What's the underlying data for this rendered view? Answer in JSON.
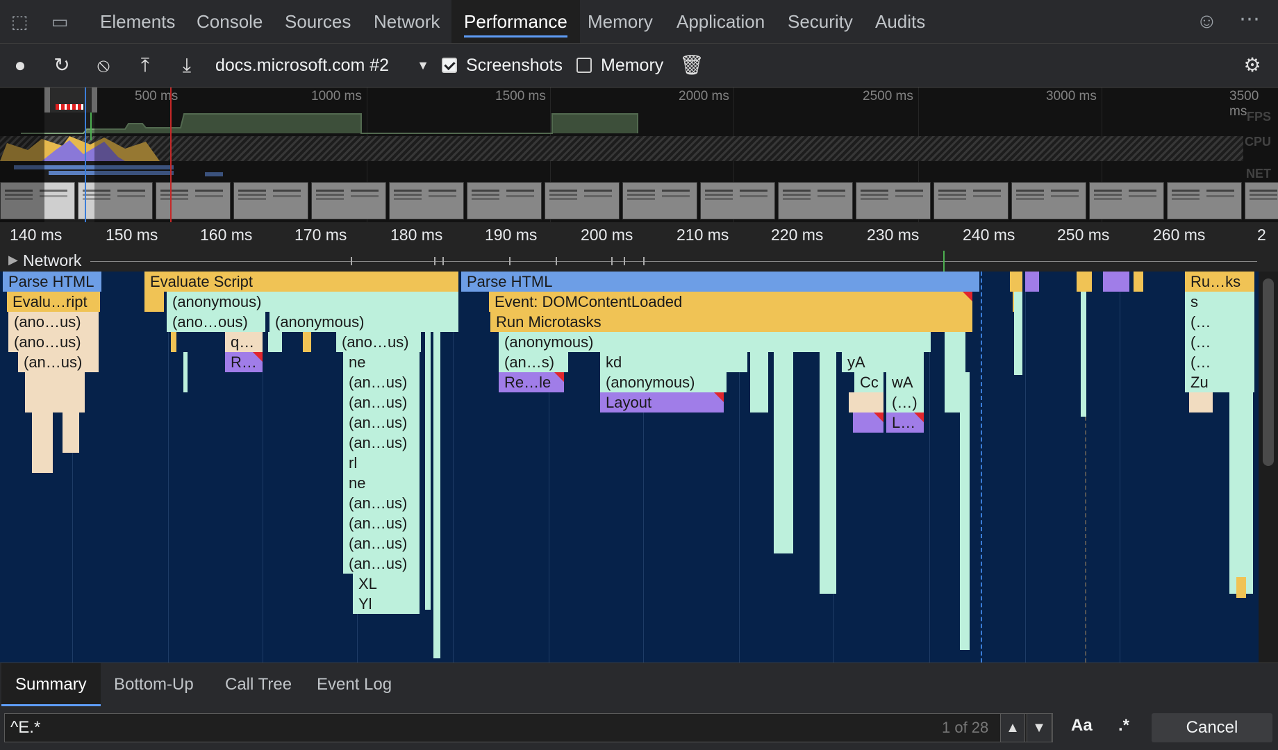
{
  "tabs": {
    "elements": "Elements",
    "console": "Console",
    "sources": "Sources",
    "network": "Network",
    "performance": "Performance",
    "memory": "Memory",
    "application": "Application",
    "security": "Security",
    "audits": "Audits"
  },
  "toolbar": {
    "recording_select": "docs.microsoft.com #2",
    "screenshots_label": "Screenshots",
    "screenshots_checked": true,
    "memory_label": "Memory",
    "memory_checked": false
  },
  "overview": {
    "ticks": [
      "500 ms",
      "1000 ms",
      "1500 ms",
      "2000 ms",
      "2500 ms",
      "3000 ms",
      "3500 ms"
    ],
    "fps_label": "FPS",
    "cpu_label": "CPU",
    "net_label": "NET"
  },
  "ruler": {
    "ticks": [
      "140 ms",
      "150 ms",
      "160 ms",
      "170 ms",
      "180 ms",
      "190 ms",
      "200 ms",
      "210 ms",
      "220 ms",
      "230 ms",
      "240 ms",
      "250 ms",
      "260 ms",
      "2"
    ]
  },
  "network_track": {
    "label": "Network"
  },
  "flame": {
    "parse_html_1": "Parse HTML",
    "evaluate_script": "Evaluate Script",
    "parse_html_2": "Parse HTML",
    "run_tasks": "Ru…ks",
    "evalu_ript": "Evalu…ript",
    "anonymous": "(anonymous)",
    "dom_content_loaded": "Event: DOMContentLoaded",
    "s": "s",
    "ano_us": "(ano…us)",
    "ano_ous": "(ano…ous)",
    "run_microtasks": "Run Microtasks",
    "paren_ellipsis": "(…",
    "q": "q…",
    "an_us": "(an…us)",
    "ne": "ne",
    "an_s": "(an…s)",
    "kd": "kd",
    "yA": "yA",
    "R": "R…",
    "Re_le": "Re…le",
    "Cc": "Cc",
    "wA": "wA",
    "Zu": "Zu",
    "layout": "Layout",
    "paren_dots": "(…)",
    "L": "L…",
    "rl": "rl",
    "XL": "XL",
    "Yl": "Yl"
  },
  "bottom_tabs": {
    "summary": "Summary",
    "bottom_up": "Bottom-Up",
    "call_tree": "Call Tree",
    "event_log": "Event Log"
  },
  "find": {
    "query": "^E.*",
    "count": "1 of 28",
    "match_case": "Aa",
    "regex": ".*",
    "cancel": "Cancel"
  },
  "colors": {
    "html": "#6d9ee6",
    "script": "#f0c355",
    "js": "#bdf0dc",
    "layout": "#a07de8",
    "flame_bg": "#06224a"
  }
}
